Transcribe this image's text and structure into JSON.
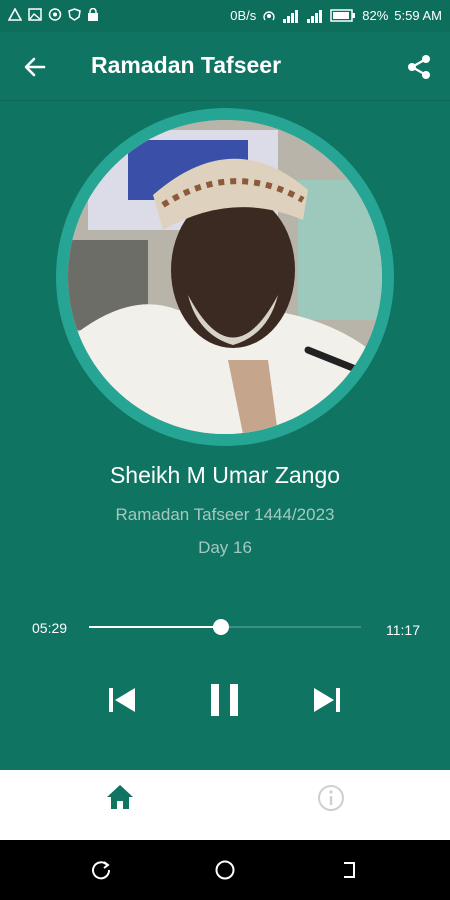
{
  "status_bar": {
    "speed": "0B/s",
    "battery": "82%",
    "time": "5:59 AM"
  },
  "header": {
    "title": "Ramadan Tafseer",
    "back_icon": "arrow-left-icon",
    "share_icon": "share-icon"
  },
  "track": {
    "speaker": "Sheikh M Umar Zango",
    "album": "Ramadan Tafseer 1444/2023",
    "episode": "Day 16"
  },
  "player": {
    "current_time": "05:29",
    "total_time": "11:17",
    "progress": 0.487,
    "controls": [
      "skip-previous-icon",
      "pause-icon",
      "skip-next-icon"
    ]
  },
  "bottom_nav": {
    "items": [
      {
        "icon": "home-icon",
        "active": true
      },
      {
        "icon": "info-icon",
        "active": false
      }
    ]
  },
  "colors": {
    "primary": "#0f7462",
    "ring": "#26a594",
    "subtext": "#a4c9c1",
    "nav_active": "#0f7462",
    "nav_inactive": "#cfcfcf"
  }
}
